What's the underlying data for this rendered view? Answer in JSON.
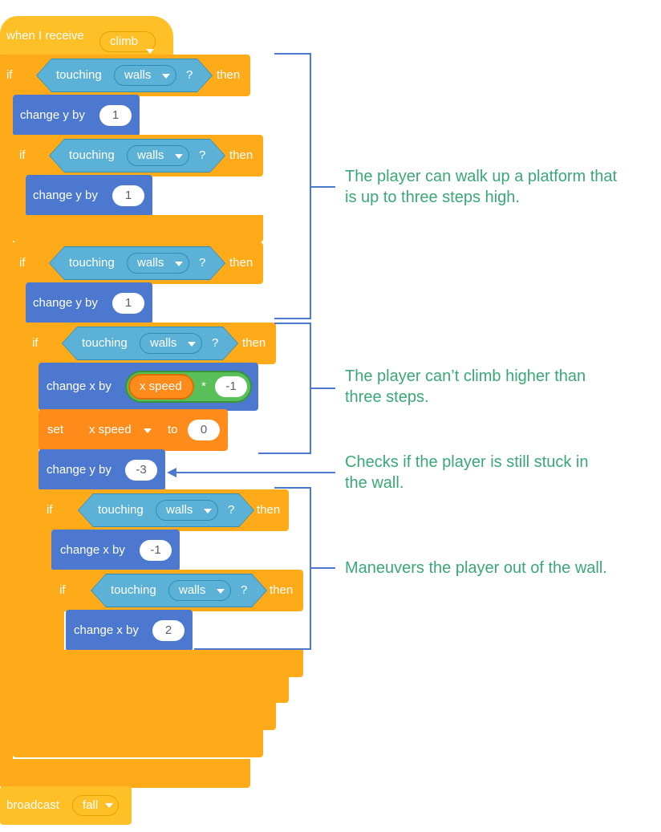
{
  "hat": {
    "label": "when I receive",
    "message": "climb"
  },
  "if1": {
    "if_label": "if",
    "sensing": "touching",
    "target": "walls",
    "q": "?",
    "then_label": "then"
  },
  "change_y_1": {
    "label": "change y by",
    "value": "1"
  },
  "if2": {
    "if_label": "if",
    "sensing": "touching",
    "target": "walls",
    "q": "?",
    "then_label": "then"
  },
  "change_y_2": {
    "label": "change y by",
    "value": "1"
  },
  "if3": {
    "if_label": "if",
    "sensing": "touching",
    "target": "walls",
    "q": "?",
    "then_label": "then"
  },
  "change_y_3": {
    "label": "change y by",
    "value": "1"
  },
  "if4": {
    "if_label": "if",
    "sensing": "touching",
    "target": "walls",
    "q": "?",
    "then_label": "then"
  },
  "change_x_1": {
    "label": "change x by",
    "variable": "x speed",
    "operator": "*",
    "value": "-1"
  },
  "set_var": {
    "label": "set",
    "variable": "x speed",
    "to_label": "to",
    "value": "0"
  },
  "change_y_4": {
    "label": "change y by",
    "value": "-3"
  },
  "if5": {
    "if_label": "if",
    "sensing": "touching",
    "target": "walls",
    "q": "?",
    "then_label": "then"
  },
  "change_x_2": {
    "label": "change x by",
    "value": "-1"
  },
  "if6": {
    "if_label": "if",
    "sensing": "touching",
    "target": "walls",
    "q": "?",
    "then_label": "then"
  },
  "change_x_3": {
    "label": "change x by",
    "value": "2"
  },
  "broadcast": {
    "label": "broadcast",
    "message": "fall"
  },
  "annotations": {
    "note1_line1": "The player can walk up a platform that",
    "note1_line2": "is up to three steps high.",
    "note2_line1": "The player can’t climb higher than",
    "note2_line2": "three steps.",
    "note3_line1": "Checks if the player is still stuck in",
    "note3_line2": "the wall.",
    "note4_line1": "Maneuvers the player out of the wall."
  },
  "colors": {
    "events": "#ffbf26",
    "control": "#ffab19",
    "motion": "#4c78d0",
    "sensing": "#5cb1d6",
    "variables": "#ff8c1a",
    "operators": "#59c059",
    "annotation_text": "#3aa876",
    "bracket": "#4c78d0"
  }
}
